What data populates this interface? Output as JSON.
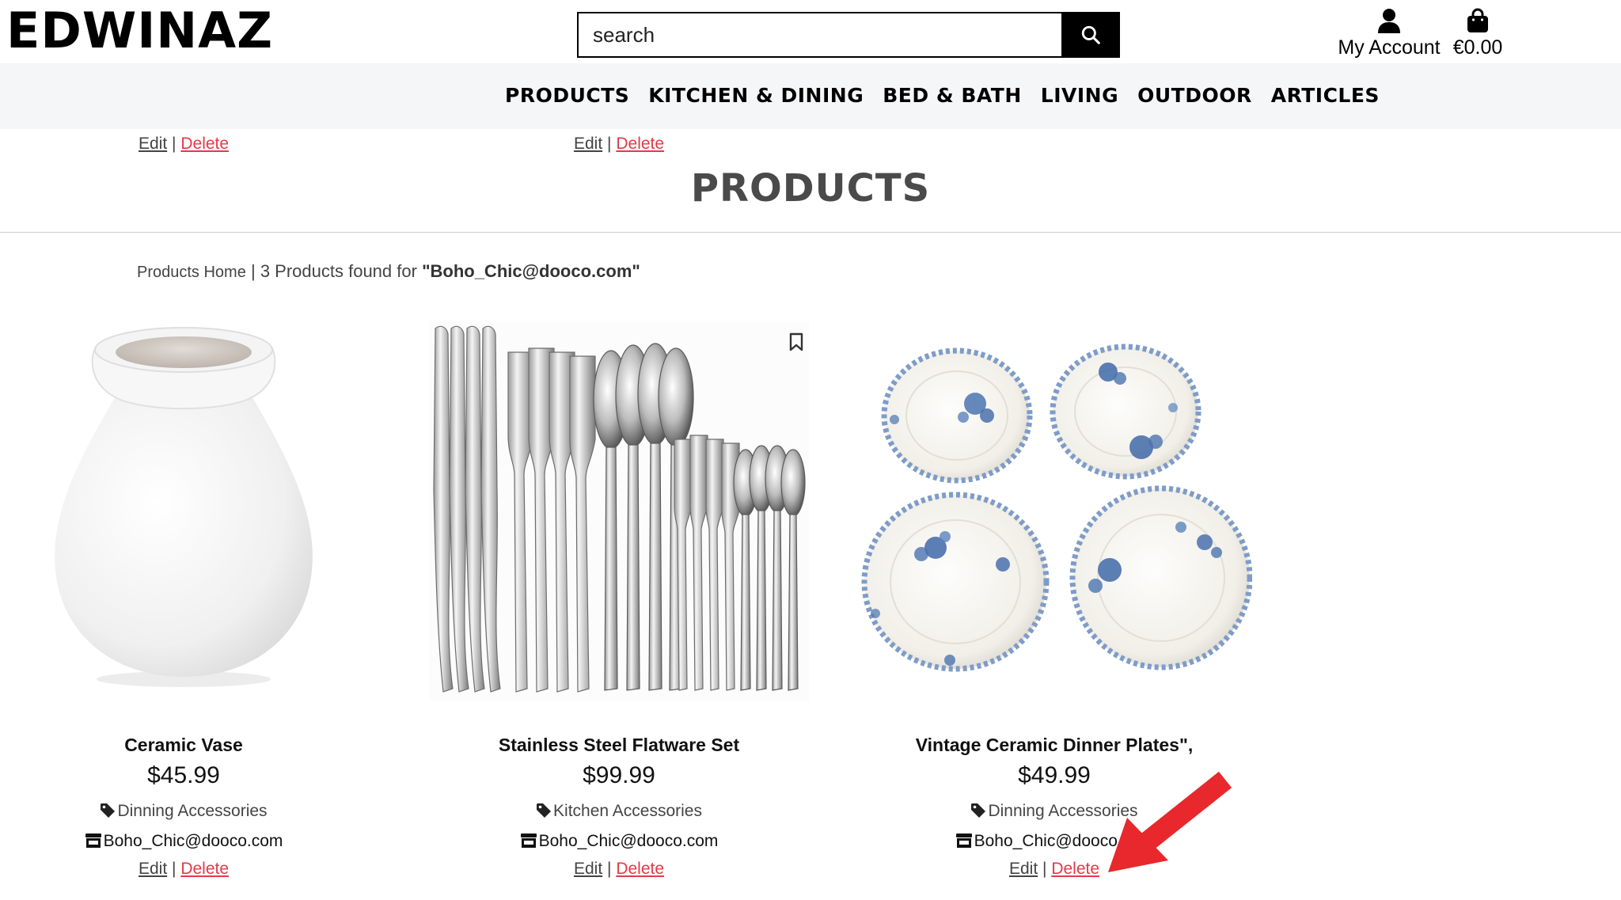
{
  "header": {
    "logo": "EDWINAZ",
    "search": {
      "placeholder": "search",
      "value": ""
    },
    "account_label": "My Account",
    "bag_total": "€0.00"
  },
  "nav": [
    "PRODUCTS",
    "KITCHEN & DINING",
    "BED & BATH",
    "LIVING",
    "OUTDOOR",
    "ARTICLES"
  ],
  "stray_actions": {
    "edit": "Edit",
    "separator": "|",
    "delete": "Delete"
  },
  "page_title": "PRODUCTS",
  "breadcrumb": {
    "home": "Products Home",
    "separator": "|",
    "count_text": "3 Products found for",
    "query": "\"Boho_Chic@dooco.com\""
  },
  "products": [
    {
      "name": "Ceramic Vase",
      "price": "$45.99",
      "category": "Dinning Accessories",
      "seller": "Boho_Chic@dooco.com",
      "edit": "Edit",
      "separator": "|",
      "delete": "Delete"
    },
    {
      "name": "Stainless Steel Flatware Set",
      "price": "$99.99",
      "category": "Kitchen Accessories",
      "seller": "Boho_Chic@dooco.com",
      "edit": "Edit",
      "separator": "|",
      "delete": "Delete"
    },
    {
      "name": "Vintage Ceramic Dinner Plates\",",
      "price": "$49.99",
      "category": "Dinning Accessories",
      "seller": "Boho_Chic@dooco.com",
      "edit": "Edit",
      "separator": "|",
      "delete": "Delete"
    }
  ],
  "colors": {
    "accent_delete": "#e23a4a",
    "nav_bg": "#f5f6f8",
    "annotation_arrow": "#e8282c"
  },
  "icons": [
    "search-icon",
    "user-icon",
    "shopping-bag-icon",
    "tag-icon",
    "store-icon",
    "bookmark-icon",
    "annotation-arrow"
  ]
}
